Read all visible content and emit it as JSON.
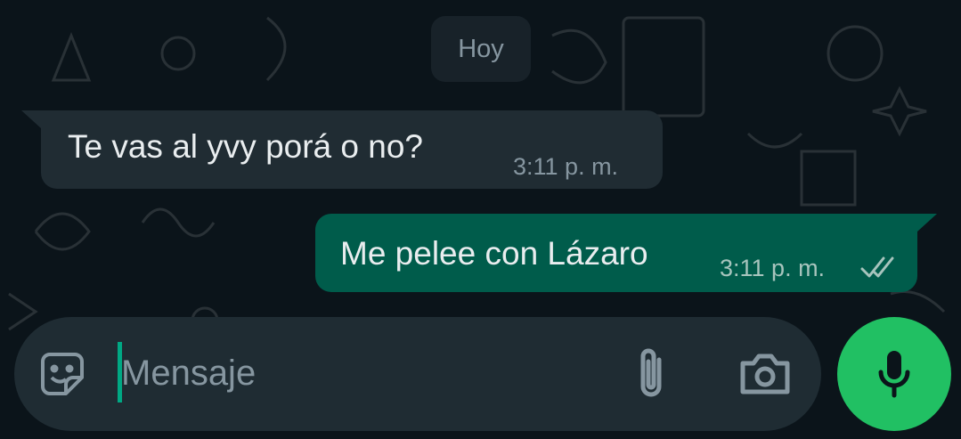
{
  "chat": {
    "date_label": "Hoy",
    "messages": [
      {
        "direction": "incoming",
        "text": "Te vas al yvy porá o no?",
        "time": "3:11 p. m."
      },
      {
        "direction": "outgoing",
        "text": "Me pelee con Lázaro",
        "time": "3:11 p. m.",
        "status_icon": "double-check-icon"
      }
    ]
  },
  "composer": {
    "placeholder": "Mensaje",
    "emoji_icon": "sticker-emoji-icon",
    "attach_icon": "paperclip-icon",
    "camera_icon": "camera-icon",
    "mic_icon": "microphone-icon"
  },
  "colors": {
    "background": "#0b141a",
    "incoming_bubble": "#202c33",
    "outgoing_bubble": "#005c4b",
    "composer": "#1f2c33",
    "mic_button": "#21c063",
    "accent": "#00a884"
  }
}
